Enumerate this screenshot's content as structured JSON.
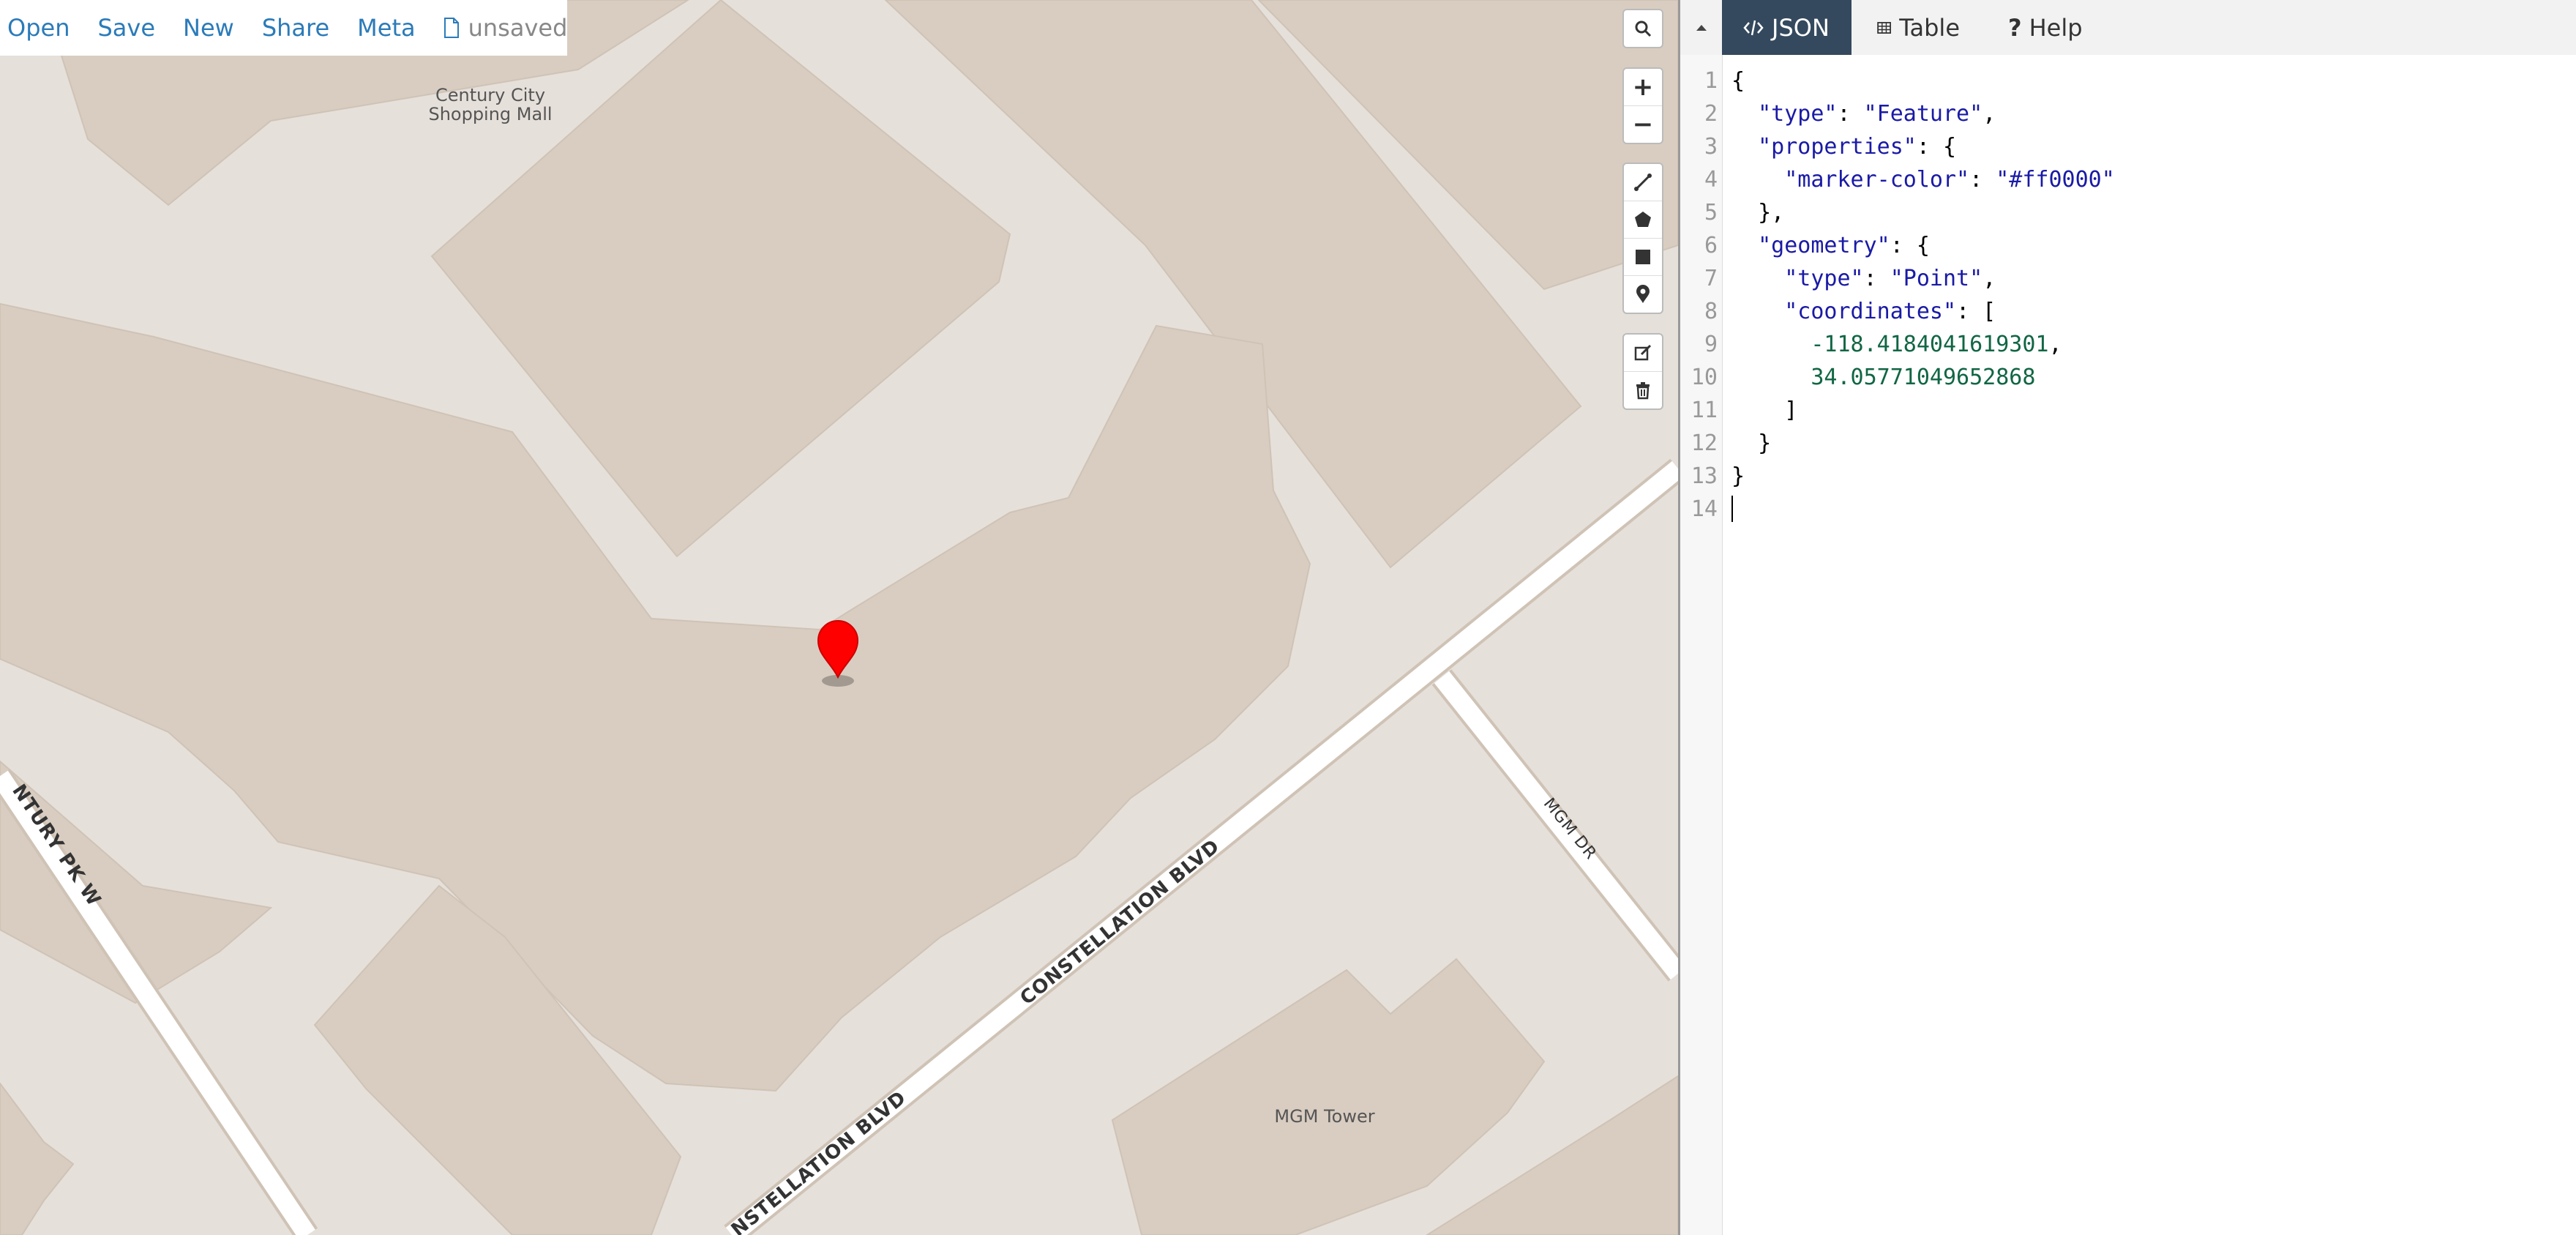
{
  "menu": {
    "open": "Open",
    "save": "Save",
    "new": "New",
    "share": "Share",
    "meta": "Meta",
    "file_status": "unsaved",
    "file_icon": "file-icon"
  },
  "map": {
    "labels": {
      "century_city_line1": "Century City",
      "century_city_line2": "Shopping Mall",
      "mgm_tower": "MGM Tower",
      "mgm_dr": "MGM DR",
      "century_pk_w": "NTURY PK W",
      "constellation_1": "CONSTELLATION BLVD",
      "constellation_2": "NSTELLATION BLVD"
    },
    "marker_color": "#ff0000",
    "controls": {
      "search": "search-icon",
      "zoom_in": "+",
      "zoom_out": "−",
      "draw_line": "line-draw-icon",
      "draw_polygon": "polygon-draw-icon",
      "draw_rectangle": "rectangle-draw-icon",
      "draw_marker": "marker-draw-icon",
      "edit": "edit-icon",
      "delete": "trash-icon"
    }
  },
  "pane": {
    "tabs": [
      {
        "label": "JSON",
        "icon": "code-icon",
        "active": true
      },
      {
        "label": "Table",
        "icon": "table-icon",
        "active": false
      },
      {
        "label": "Help",
        "icon": "question-icon",
        "active": false
      }
    ],
    "accent_color": "#34495e",
    "editor": {
      "line_numbers": [
        "1",
        "2",
        "3",
        "4",
        "5",
        "6",
        "7",
        "8",
        "9",
        "10",
        "11",
        "12",
        "13",
        "14"
      ],
      "lines": {
        "l1": "{",
        "l2_key": "\"type\"",
        "l2_sep": ": ",
        "l2_val": "\"Feature\"",
        "l2_end": ",",
        "l3_key": "\"properties\"",
        "l3_rest": ": {",
        "l4_key": "\"marker-color\"",
        "l4_sep": ": ",
        "l4_val": "\"#ff0000\"",
        "l5": "},",
        "l6_key": "\"geometry\"",
        "l6_rest": ": {",
        "l7_key": "\"type\"",
        "l7_sep": ": ",
        "l7_val": "\"Point\"",
        "l7_end": ",",
        "l8_key": "\"coordinates\"",
        "l8_rest": ": [",
        "l9_val": "-118.4184041619301",
        "l9_end": ",",
        "l10_val": "34.05771049652868",
        "l11": "]",
        "l12": "}",
        "l13": "}"
      }
    }
  }
}
